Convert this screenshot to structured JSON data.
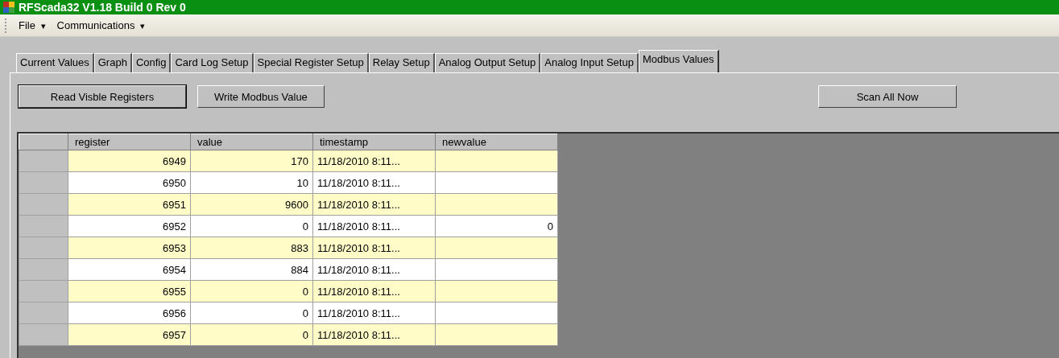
{
  "window": {
    "title": "RFScada32 V1.18 Build 0 Rev 0"
  },
  "menu": [
    {
      "label": "File",
      "arrow": "▾"
    },
    {
      "label": "Communications",
      "arrow": "▾"
    }
  ],
  "tabs": [
    {
      "label": "Current Values",
      "selected": false
    },
    {
      "label": "Graph",
      "selected": false
    },
    {
      "label": "Config",
      "selected": false
    },
    {
      "label": "Card Log Setup",
      "selected": false
    },
    {
      "label": "Special Register Setup",
      "selected": false
    },
    {
      "label": "Relay Setup",
      "selected": false
    },
    {
      "label": "Analog Output Setup",
      "selected": false
    },
    {
      "label": "Analog Input Setup",
      "selected": false
    },
    {
      "label": "Modbus Values",
      "selected": true
    }
  ],
  "buttons": [
    {
      "label": "Read Visble Registers",
      "default": true
    },
    {
      "label": "Write Modbus Value",
      "default": false
    }
  ],
  "scan_button": {
    "label": "Scan All Now"
  },
  "table": {
    "columns": [
      "register",
      "value",
      "timestamp",
      "newvalue"
    ],
    "rows": [
      [
        "6949",
        "170",
        "11/18/2010 8:11...",
        ""
      ],
      [
        "6950",
        "10",
        "11/18/2010 8:11...",
        ""
      ],
      [
        "6951",
        "9600",
        "11/18/2010 8:11...",
        ""
      ],
      [
        "6952",
        "0",
        "11/18/2010 8:11...",
        "0"
      ],
      [
        "6953",
        "883",
        "11/18/2010 8:11...",
        ""
      ],
      [
        "6954",
        "884",
        "11/18/2010 8:11...",
        ""
      ],
      [
        "6955",
        "0",
        "11/18/2010 8:11...",
        ""
      ],
      [
        "6956",
        "0",
        "11/18/2010 8:11...",
        ""
      ],
      [
        "6957",
        "0",
        "11/18/2010 8:11...",
        ""
      ]
    ]
  }
}
